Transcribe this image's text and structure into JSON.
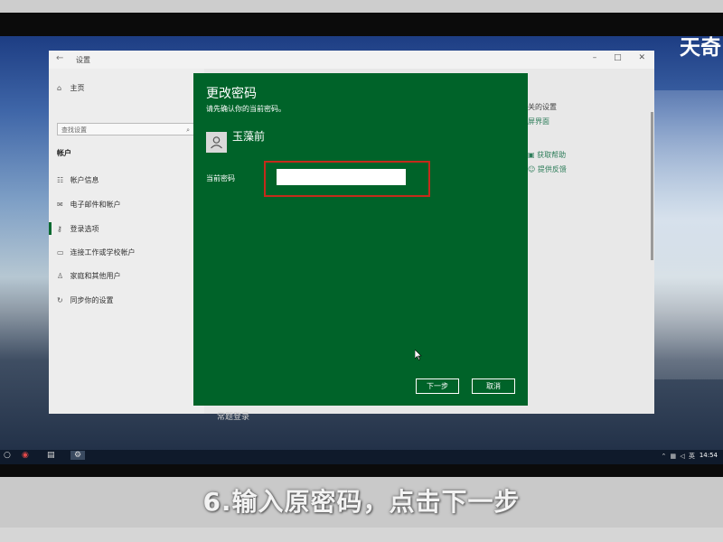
{
  "brand": {
    "text": "天奇"
  },
  "settings": {
    "window_title": "设置",
    "home": "主页",
    "search_placeholder": "查找设置",
    "section": "帐户",
    "nav_items": [
      {
        "label": "帐户信息",
        "icon": "person-card-icon"
      },
      {
        "label": "电子邮件和帐户",
        "icon": "mail-icon"
      },
      {
        "label": "登录选项",
        "icon": "key-icon"
      },
      {
        "label": "连接工作或学校帐户",
        "icon": "briefcase-icon"
      },
      {
        "label": "家庭和其他用户",
        "icon": "people-icon"
      },
      {
        "label": "同步你的设置",
        "icon": "sync-icon"
      }
    ],
    "right_links": {
      "related_partial": "关的设置",
      "lock_screen_partial": "屏界面",
      "get_help": "获取帮助",
      "feedback": "提供反馈"
    }
  },
  "dialog": {
    "title": "更改密码",
    "subtitle": "请先确认你的当前密码。",
    "user_name": "玉藻前",
    "password_label": "当前密码",
    "password_value": "",
    "next_button": "下一步",
    "cancel_button": "取消",
    "accent_color": "#006329",
    "highlight_color": "#c52b1b"
  },
  "below_dialog_text": "常题登录",
  "taskbar": {
    "clock": "14:54",
    "ime": "英"
  },
  "caption": "6.输入原密码，点击下一步"
}
